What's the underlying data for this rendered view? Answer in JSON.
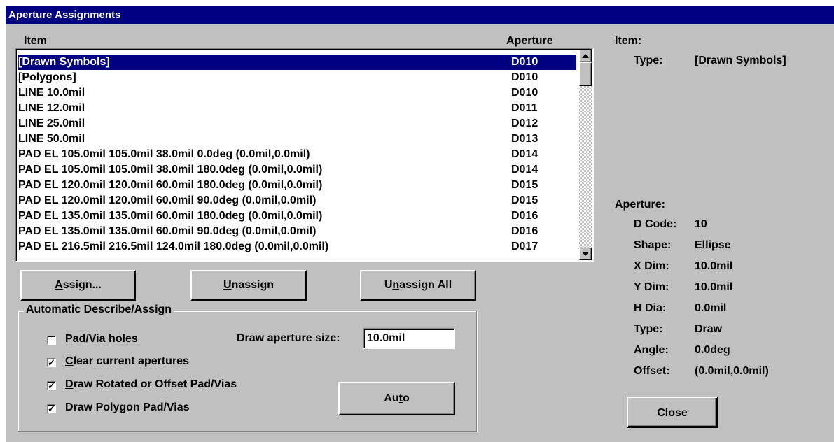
{
  "window": {
    "title": "Aperture Assignments"
  },
  "list": {
    "header_item": "Item",
    "header_aperture": "Aperture",
    "rows": [
      {
        "item": "[Drawn Symbols]",
        "aperture": "D010",
        "selected": true
      },
      {
        "item": "[Polygons]",
        "aperture": "D010"
      },
      {
        "item": "LINE 10.0mil",
        "aperture": "D010"
      },
      {
        "item": "LINE 12.0mil",
        "aperture": "D011"
      },
      {
        "item": "LINE 25.0mil",
        "aperture": "D012"
      },
      {
        "item": "LINE 50.0mil",
        "aperture": "D013"
      },
      {
        "item": "PAD EL 105.0mil 105.0mil 38.0mil 0.0deg (0.0mil,0.0mil)",
        "aperture": "D014"
      },
      {
        "item": "PAD EL 105.0mil 105.0mil 38.0mil 180.0deg (0.0mil,0.0mil)",
        "aperture": "D014"
      },
      {
        "item": "PAD EL 120.0mil 120.0mil 60.0mil 180.0deg (0.0mil,0.0mil)",
        "aperture": "D015"
      },
      {
        "item": "PAD EL 120.0mil 120.0mil 60.0mil 90.0deg (0.0mil,0.0mil)",
        "aperture": "D015"
      },
      {
        "item": "PAD EL 135.0mil 135.0mil 60.0mil 180.0deg (0.0mil,0.0mil)",
        "aperture": "D016"
      },
      {
        "item": "PAD EL 135.0mil 135.0mil 60.0mil 90.0deg (0.0mil,0.0mil)",
        "aperture": "D016"
      },
      {
        "item": "PAD EL 216.5mil 216.5mil 124.0mil 180.0deg (0.0mil,0.0mil)",
        "aperture": "D017"
      }
    ]
  },
  "buttons": {
    "assign": {
      "hotkey": "A",
      "rest": "ssign..."
    },
    "unassign": {
      "hotkey": "U",
      "rest": "nassign"
    },
    "unassign_all": {
      "pre": "U",
      "hotkey": "n",
      "rest": "assign All"
    },
    "auto": {
      "pre": "Au",
      "hotkey": "t",
      "rest": "o"
    },
    "close": "Close"
  },
  "auto_group": {
    "label": "Automatic Describe/Assign",
    "draw_size_label": "Draw aperture size:",
    "draw_size_value": "10.0mil",
    "checkboxes": [
      {
        "hotkey": "P",
        "rest": "ad/Via holes",
        "checked": false
      },
      {
        "hotkey": "C",
        "rest": "lear current apertures",
        "checked": true
      },
      {
        "hotkey": "D",
        "rest": "raw Rotated or Offset Pad/Vias",
        "checked": true
      },
      {
        "hotkey": "",
        "rest": "Draw Polygon Pad/Vias",
        "checked": true
      }
    ]
  },
  "item_info": {
    "heading": "Item:",
    "type_label": "Type:",
    "type_value": "[Drawn Symbols]"
  },
  "aperture_info": {
    "heading": "Aperture:",
    "fields": [
      {
        "label": "D Code:",
        "value": "10"
      },
      {
        "label": "Shape:",
        "value": "Ellipse"
      },
      {
        "label": "X Dim:",
        "value": "10.0mil"
      },
      {
        "label": "Y Dim:",
        "value": "10.0mil"
      },
      {
        "label": "H Dia:",
        "value": "0.0mil"
      },
      {
        "label": "Type:",
        "value": "Draw"
      },
      {
        "label": "Angle:",
        "value": "0.0deg"
      },
      {
        "label": "Offset:",
        "value": "(0.0mil,0.0mil)"
      }
    ]
  }
}
